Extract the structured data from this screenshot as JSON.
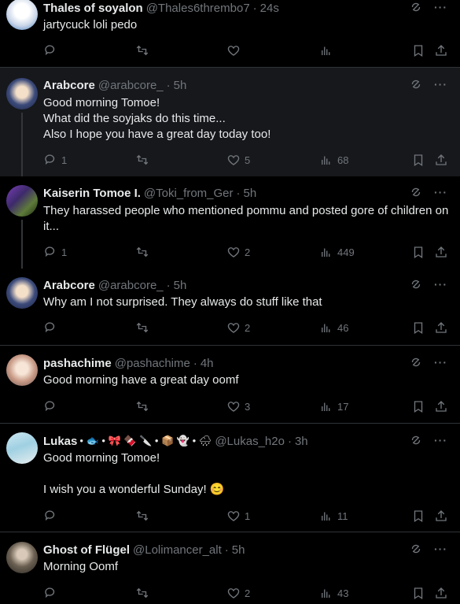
{
  "tweets": [
    {
      "name": "Thales of soyalon",
      "handle": "@Thales6thrembo7",
      "time": "24s",
      "text": "jartycuck loli pedo",
      "replies": "",
      "retweets": "",
      "likes": "",
      "views": "",
      "emoji": ""
    },
    {
      "name": "Arabcore",
      "handle": "@arabcore_",
      "time": "5h",
      "text": "Good morning Tomoe!\nWhat did the soyjaks do this time...\nAlso I hope you have a great day today too!",
      "replies": "1",
      "retweets": "",
      "likes": "5",
      "views": "68",
      "emoji": ""
    },
    {
      "name": "Kaiserin Tomoe I.",
      "handle": "@Toki_from_Ger",
      "time": "5h",
      "text": "They harassed people who mentioned pommu and posted gore of children on it...",
      "replies": "1",
      "retweets": "",
      "likes": "2",
      "views": "449",
      "emoji": ""
    },
    {
      "name": "Arabcore",
      "handle": "@arabcore_",
      "time": "5h",
      "text": "Why am I not surprised. They always do stuff like that",
      "replies": "",
      "retweets": "",
      "likes": "2",
      "views": "46",
      "emoji": ""
    },
    {
      "name": "pashachime",
      "handle": "@pashachime",
      "time": "4h",
      "text": "Good morning have a great day oomf",
      "replies": "",
      "retweets": "",
      "likes": "3",
      "views": "17",
      "emoji": ""
    },
    {
      "name": "Lukas",
      "handle": "@Lukas_h2o",
      "time": "3h",
      "text": "Good morning Tomoe!\n\nI wish you a wonderful Sunday! 😊",
      "replies": "",
      "retweets": "",
      "likes": "1",
      "views": "11",
      "emoji": "• 🐟 • 🎀 🍫 🔪 • 📦 👻 • 🌧"
    },
    {
      "name": "Ghost of Flügel",
      "handle": "@Lolimancer_alt",
      "time": "5h",
      "text": "Morning Oomf",
      "replies": "",
      "retweets": "",
      "likes": "2",
      "views": "43",
      "emoji": ""
    }
  ],
  "icons": {
    "reply": "reply-icon",
    "retweet": "retweet-icon",
    "like": "heart-icon",
    "views": "views-icon",
    "bookmark": "bookmark-icon",
    "share": "share-icon",
    "grok": "grok-icon",
    "more": "more-icon"
  },
  "colors": {
    "background": "#000000",
    "text": "#e7e9ea",
    "muted": "#71767b",
    "divider": "#2f3336",
    "highlight": "#16181c"
  }
}
